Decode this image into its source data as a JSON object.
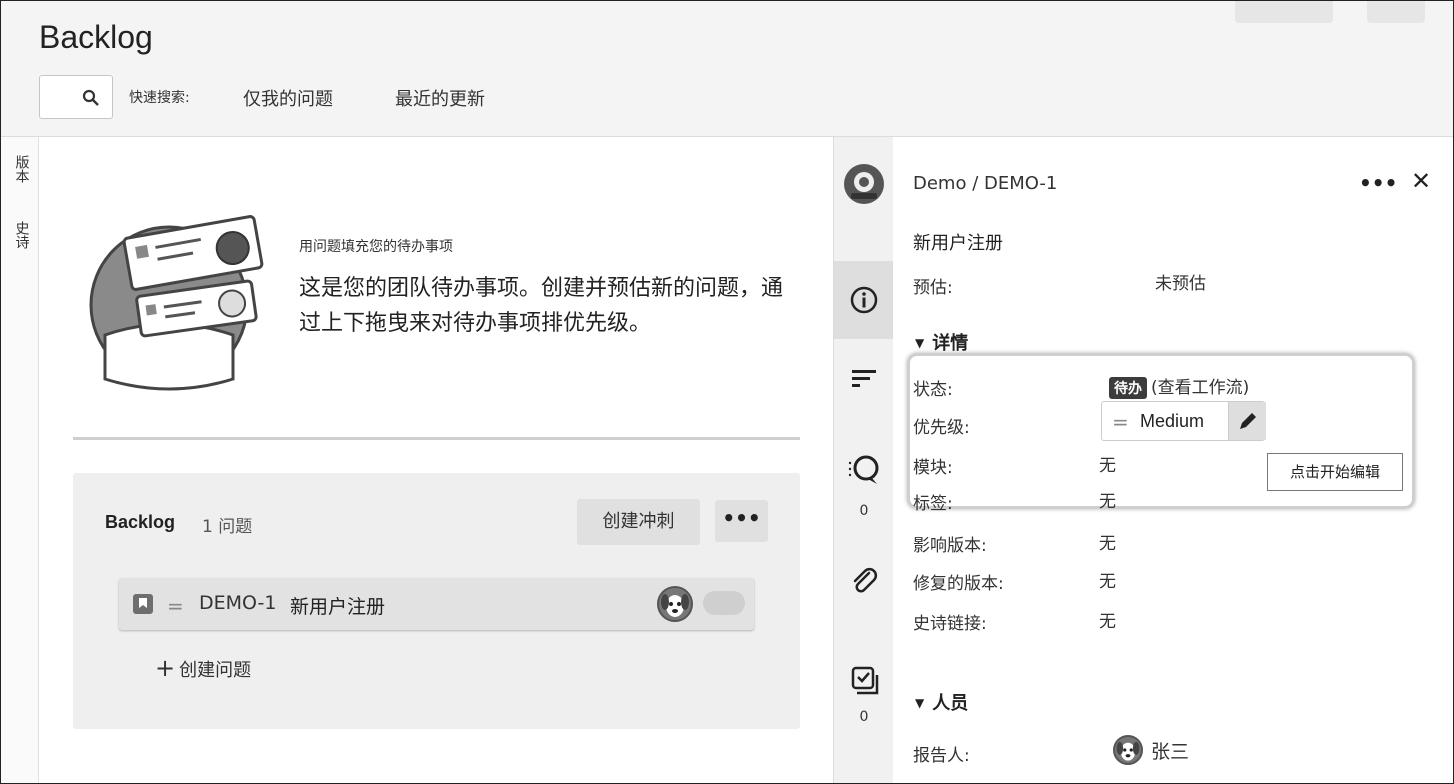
{
  "header": {
    "title": "Backlog",
    "quick_search_label": "快速搜索:",
    "quick_filters": [
      "仅我的问题",
      "最近的更新"
    ]
  },
  "left_tabs": [
    "版本",
    "史诗"
  ],
  "onboarding": {
    "title": "用问题填充您的待办事项",
    "description": "这是您的团队待办事项。创建并预估新的问题，通过上下拖曳来对待办事项排优先级。"
  },
  "backlog": {
    "name": "Backlog",
    "count": "1 问题",
    "create_sprint": "创建冲刺",
    "more": "•••",
    "issue": {
      "key": "DEMO-1",
      "summary": "新用户注册"
    },
    "create_issue": "创建问题"
  },
  "icon_strip": {
    "comment_count": "0",
    "checklist_count": "0",
    "icons": [
      "project-avatar-icon",
      "info-icon",
      "sort-icon",
      "comment-icon",
      "attachment-icon",
      "checklist-icon"
    ]
  },
  "detail": {
    "breadcrumb": "Demo / DEMO-1",
    "more": "•••",
    "close": "✕",
    "summary": "新用户注册",
    "estimate_label": "预估:",
    "estimate_value": "未预估",
    "details_section": "详情",
    "status_label": "状态:",
    "status_lozenge": "待办",
    "status_link": "(查看工作流)",
    "priority_label": "优先级:",
    "priority_value": "Medium",
    "component_label": "模块:",
    "component_value": "无",
    "tooltip": "点击开始编辑",
    "labels_label": "标签:",
    "labels_value": "无",
    "affects_label": "影响版本:",
    "affects_value": "无",
    "fix_label": "修复的版本:",
    "fix_value": "无",
    "epic_label": "史诗链接:",
    "epic_value": "无",
    "people_section": "人员",
    "reporter_label": "报告人:",
    "reporter_value": "张三"
  },
  "colors": {
    "header_bg": "#f4f4f4",
    "panel_bg": "#efefef",
    "lozenge_bg": "#3c3c3c"
  }
}
